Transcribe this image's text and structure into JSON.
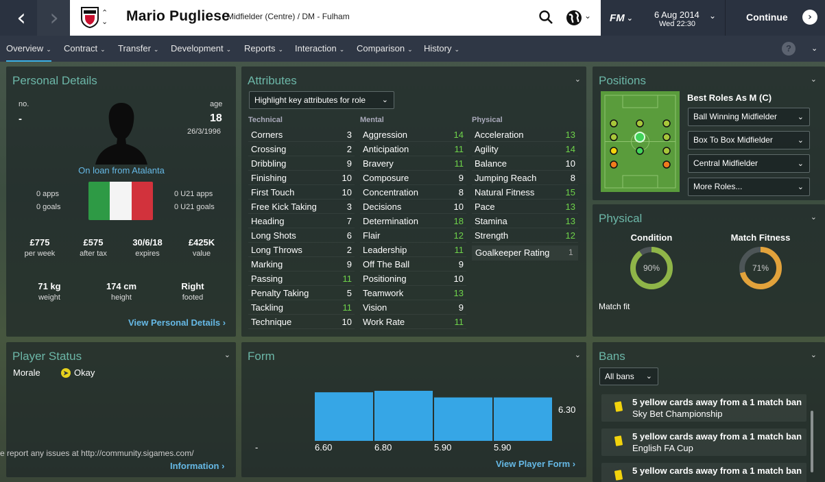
{
  "header": {
    "player_name": "Mario Pugliese",
    "player_subtitle": "Midfielder (Centre) / DM - Fulham",
    "date": "6 Aug 2014",
    "day_time": "Wed 22:30",
    "fm_logo": "FM",
    "continue_label": "Continue"
  },
  "tabs": [
    {
      "label": "Overview"
    },
    {
      "label": "Contract"
    },
    {
      "label": "Transfer"
    },
    {
      "label": "Development"
    },
    {
      "label": "Reports"
    },
    {
      "label": "Interaction"
    },
    {
      "label": "Comparison"
    },
    {
      "label": "History"
    }
  ],
  "help_label": "?",
  "personal": {
    "title": "Personal Details",
    "no_label": "no.",
    "no_value": "-",
    "age_label": "age",
    "age_value": "18",
    "dob": "26/3/1996",
    "loan_text": "On loan from Atalanta",
    "apps": "0 apps",
    "goals": "0 goals",
    "u21_apps": "0 U21 apps",
    "u21_goals": "0 U21 goals",
    "wage_value": "£775",
    "wage_label": "per week",
    "aftertax_value": "£575",
    "aftertax_label": "after tax",
    "expires_value": "30/6/18",
    "expires_label": "expires",
    "value_value": "£425K",
    "value_label": "value",
    "weight_value": "71 kg",
    "weight_label": "weight",
    "height_value": "174 cm",
    "height_label": "height",
    "foot_value": "Right",
    "foot_label": "footed",
    "link": "View Personal Details"
  },
  "attributes": {
    "title": "Attributes",
    "dropdown": "Highlight key attributes for role",
    "technical_label": "Technical",
    "mental_label": "Mental",
    "physical_label": "Physical",
    "technical": [
      {
        "name": "Corners",
        "value": "3",
        "hl": false
      },
      {
        "name": "Crossing",
        "value": "2",
        "hl": false
      },
      {
        "name": "Dribbling",
        "value": "9",
        "hl": false
      },
      {
        "name": "Finishing",
        "value": "10",
        "hl": false
      },
      {
        "name": "First Touch",
        "value": "10",
        "hl": false
      },
      {
        "name": "Free Kick Taking",
        "value": "3",
        "hl": false
      },
      {
        "name": "Heading",
        "value": "7",
        "hl": false
      },
      {
        "name": "Long Shots",
        "value": "6",
        "hl": false
      },
      {
        "name": "Long Throws",
        "value": "2",
        "hl": false
      },
      {
        "name": "Marking",
        "value": "9",
        "hl": false
      },
      {
        "name": "Passing",
        "value": "11",
        "hl": true
      },
      {
        "name": "Penalty Taking",
        "value": "5",
        "hl": false
      },
      {
        "name": "Tackling",
        "value": "11",
        "hl": true
      },
      {
        "name": "Technique",
        "value": "10",
        "hl": false
      }
    ],
    "mental": [
      {
        "name": "Aggression",
        "value": "14",
        "hl": true
      },
      {
        "name": "Anticipation",
        "value": "11",
        "hl": true
      },
      {
        "name": "Bravery",
        "value": "11",
        "hl": true
      },
      {
        "name": "Composure",
        "value": "9",
        "hl": false
      },
      {
        "name": "Concentration",
        "value": "8",
        "hl": false
      },
      {
        "name": "Decisions",
        "value": "10",
        "hl": false
      },
      {
        "name": "Determination",
        "value": "18",
        "hl": true
      },
      {
        "name": "Flair",
        "value": "12",
        "hl": true
      },
      {
        "name": "Leadership",
        "value": "11",
        "hl": true
      },
      {
        "name": "Off The Ball",
        "value": "9",
        "hl": false
      },
      {
        "name": "Positioning",
        "value": "10",
        "hl": false
      },
      {
        "name": "Teamwork",
        "value": "13",
        "hl": true
      },
      {
        "name": "Vision",
        "value": "9",
        "hl": false
      },
      {
        "name": "Work Rate",
        "value": "11",
        "hl": true
      }
    ],
    "physical": [
      {
        "name": "Acceleration",
        "value": "13",
        "hl": true
      },
      {
        "name": "Agility",
        "value": "14",
        "hl": true
      },
      {
        "name": "Balance",
        "value": "10",
        "hl": false
      },
      {
        "name": "Jumping Reach",
        "value": "8",
        "hl": false
      },
      {
        "name": "Natural Fitness",
        "value": "15",
        "hl": true
      },
      {
        "name": "Pace",
        "value": "13",
        "hl": true
      },
      {
        "name": "Stamina",
        "value": "13",
        "hl": true
      },
      {
        "name": "Strength",
        "value": "12",
        "hl": true
      }
    ],
    "gk_label": "Goalkeeper Rating",
    "gk_value": "1"
  },
  "positions": {
    "title": "Positions",
    "best_roles": "Best Roles As M (C)",
    "roles": [
      "Ball Winning Midfielder",
      "Box To Box Midfielder",
      "Central Midfielder",
      "More Roles..."
    ]
  },
  "physical": {
    "title": "Physical",
    "condition_label": "Condition",
    "condition_value": "90%",
    "condition_level": 0.9,
    "fitness_label": "Match Fitness",
    "fitness_value": "71%",
    "fitness_level": 0.71,
    "status": "Match fit",
    "colors": {
      "condition": "#8fb548",
      "fitness": "#e2a23b",
      "track": "#4d5557"
    }
  },
  "status": {
    "title": "Player Status",
    "morale_label": "Morale",
    "morale_value": "Okay",
    "footer_text": "e report any issues at http://community.sigames.com/",
    "link": "Information"
  },
  "form": {
    "title": "Form",
    "link": "View Player Form",
    "first_label": "-"
  },
  "chart_data": {
    "type": "bar",
    "categories": [
      "-",
      "6.60",
      "6.80",
      "5.90",
      "5.90",
      "6.30"
    ],
    "values": [
      null,
      6.6,
      6.8,
      5.9,
      5.9,
      6.3
    ],
    "title": "",
    "color": "#36a6e6"
  },
  "bans": {
    "title": "Bans",
    "filter": "All bans",
    "items": [
      {
        "text": "5 yellow cards away from a 1 match ban",
        "competition": "Sky Bet Championship"
      },
      {
        "text": "5 yellow cards away from a 1 match ban",
        "competition": "English FA Cup"
      },
      {
        "text": "5 yellow cards away from a 1 match ban",
        "competition": ""
      }
    ]
  }
}
